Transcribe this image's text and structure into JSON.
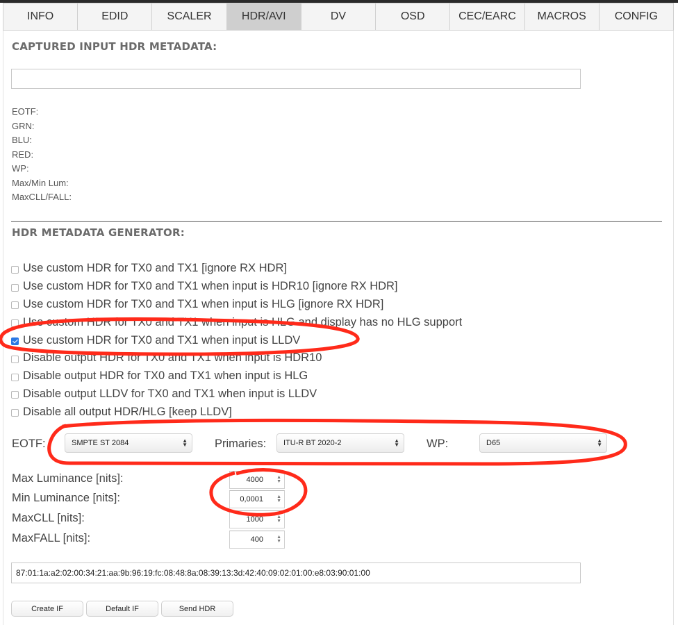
{
  "tabs": [
    "INFO",
    "EDID",
    "SCALER",
    "HDR/AVI",
    "DV",
    "OSD",
    "CEC/EARC",
    "MACROS",
    "CONFIG"
  ],
  "active_tab": "HDR/AVI",
  "captured": {
    "title": "CAPTURED INPUT HDR METADATA:",
    "value": "",
    "fields": [
      "EOTF:",
      "GRN:",
      "BLU:",
      "RED:",
      "WP:",
      "Max/Min Lum:",
      "MaxCLL/FALL:"
    ]
  },
  "generator": {
    "title": "HDR METADATA GENERATOR:",
    "options": [
      {
        "label": "Use custom HDR for TX0 and TX1 [ignore RX HDR]",
        "checked": false
      },
      {
        "label": "Use custom HDR for TX0 and TX1 when input is HDR10 [ignore RX HDR]",
        "checked": false
      },
      {
        "label": "Use custom HDR for TX0 and TX1 when input is HLG [ignore RX HDR]",
        "checked": false
      },
      {
        "label": "Use custom HDR for TX0 and TX1 when input is HLG and display has no HLG support",
        "checked": false
      },
      {
        "label": "Use custom HDR for TX0 and TX1 when input is LLDV",
        "checked": true
      },
      {
        "label": "Disable output HDR for TX0 and TX1 when input is HDR10",
        "checked": false
      },
      {
        "label": "Disable output HDR for TX0 and TX1 when input is HLG",
        "checked": false
      },
      {
        "label": "Disable output LLDV for TX0 and TX1 when input is LLDV",
        "checked": false
      },
      {
        "label": "Disable all output HDR/HLG [keep LLDV]",
        "checked": false
      }
    ],
    "eotf_label": "EOTF:",
    "eotf_value": "SMPTE ST 2084",
    "primaries_label": "Primaries:",
    "primaries_value": "ITU-R BT 2020-2",
    "wp_label": "WP:",
    "wp_value": "D65",
    "max_lum_label": "Max Luminance [nits]:",
    "max_lum_value": "4000",
    "min_lum_label": "Min Luminance [nits]:",
    "min_lum_value": "0,0001",
    "maxcll_label": "MaxCLL [nits]:",
    "maxcll_value": "1000",
    "maxfall_label": "MaxFALL [nits]:",
    "maxfall_value": "400",
    "hex": "87:01:1a:a2:02:00:34:21:aa:9b:96:19:fc:08:48:8a:08:39:13:3d:42:40:09:02:01:00:e8:03:90:01:00",
    "buttons": {
      "create": "Create IF",
      "default": "Default IF",
      "send": "Send HDR"
    }
  },
  "colors": {
    "annotation": "#ff2a1a",
    "checkbox_checked": "#2a78e4",
    "active_tab": "#cfcfcf"
  }
}
